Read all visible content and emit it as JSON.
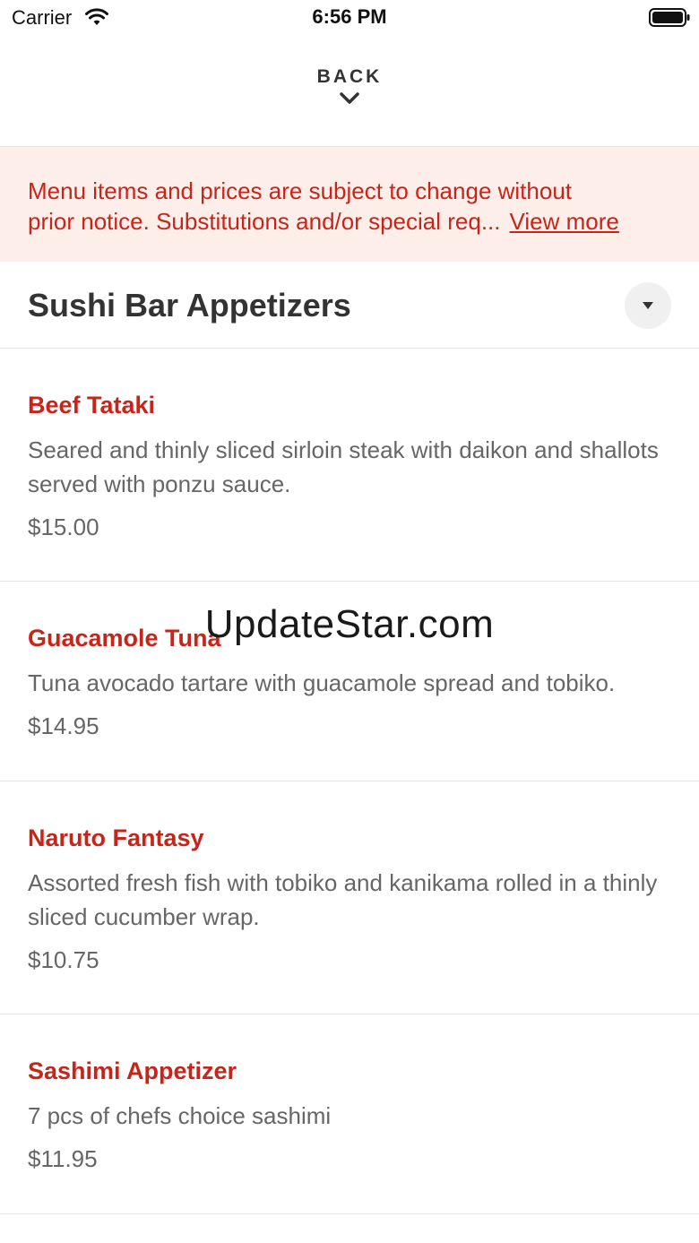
{
  "status_bar": {
    "carrier": "Carrier",
    "time": "6:56 PM"
  },
  "nav": {
    "back_label": "BACK",
    "chevron_icon": "chevron-down-icon"
  },
  "notice": {
    "line1": "Menu items and prices are subject to change without",
    "line2": "prior notice. Substitutions and/or special req...",
    "view_more": "View more"
  },
  "section": {
    "title": "Sushi Bar Appetizers",
    "toggle_icon": "caret-down-icon"
  },
  "items": [
    {
      "name": "Beef Tataki",
      "desc": "Seared and thinly sliced sirloin steak with daikon and shallots served with ponzu sauce.",
      "price": "$15.00"
    },
    {
      "name": "Guacamole Tuna",
      "desc": "Tuna avocado tartare with guacamole spread and tobiko.",
      "price": "$14.95"
    },
    {
      "name": "Naruto Fantasy",
      "desc": "Assorted fresh fish with tobiko and kanikama rolled in a thinly sliced cucumber wrap.",
      "price": "$10.75"
    },
    {
      "name": "Sashimi Appetizer",
      "desc": "7 pcs of chefs choice sashimi",
      "price": "$11.95"
    }
  ],
  "watermark": "UpdateStar.com",
  "colors": {
    "accent": "#c8251a",
    "notice_bg": "#fdeeea",
    "text_primary": "#333333",
    "text_secondary": "#666666"
  }
}
